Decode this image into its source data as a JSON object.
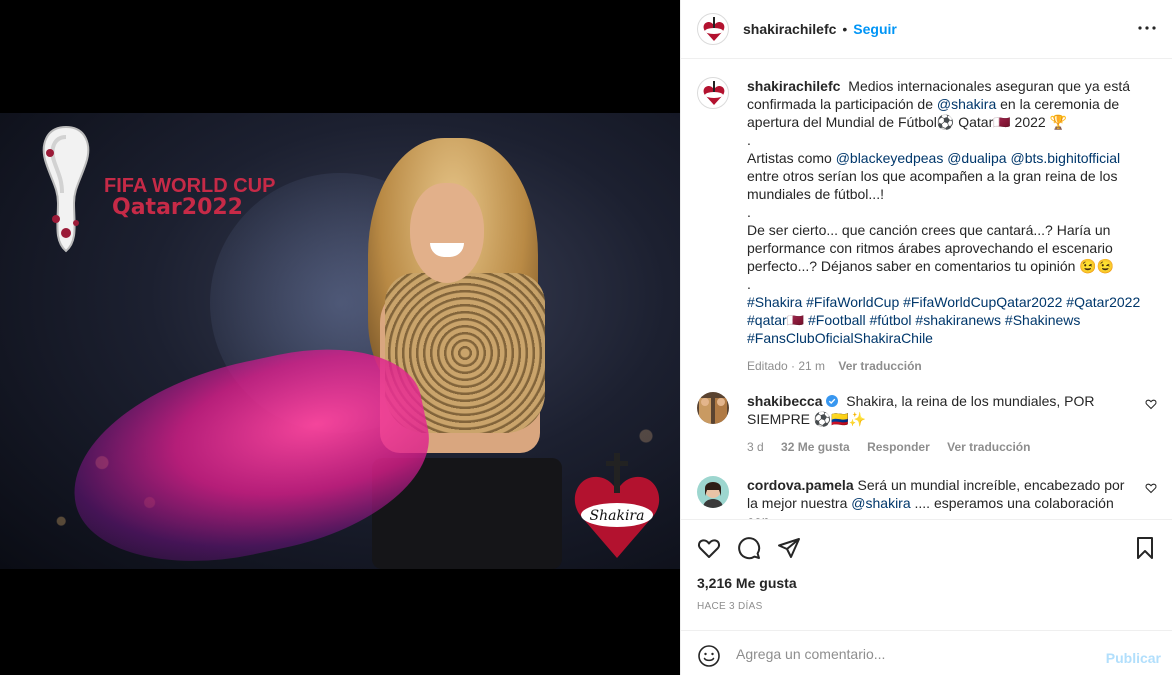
{
  "post": {
    "username": "shakirachilefc",
    "follow_label": "Seguir",
    "separator": "•"
  },
  "media": {
    "logo_line1": "FIFA WORLD CUP",
    "logo_line2": "Qatar2022"
  },
  "caption": {
    "username": "shakirachilefc",
    "lines": [
      "Medios internacionales aseguran que ya está confirmada la participación de",
      "@shakira",
      "en la ceremonia de apertura del Mundial de Fútbol⚽ Qatar🇶🇦 2022 🏆",
      ".",
      "Artistas como",
      "@blackeyedpeas",
      "@dualipa",
      "@bts.bighitofficial",
      "entre otros serían los que acompañen a la gran reina de los mundiales de fútbol...!",
      ".",
      "De ser cierto... que canción crees que cantará...? Haría un performance con ritmos árabes aprovechando el escenario perfecto...? Déjanos saber en comentarios tu opinión 😉😉",
      ".",
      "#Shakira #FifaWorldCup #FifaWorldCupQatar2022 #Qatar2022 #qatar🇶🇦 #Football #fútbol #shakiranews #Shakinews #FansClubOficialShakiraChile"
    ],
    "edited": "Editado · 21 m",
    "see_translation": "Ver traducción"
  },
  "comments": [
    {
      "username": "shakibecca",
      "text": "Shakira, la reina de los mundiales, POR SIEMPRE ⚽🇨🇴✨",
      "time": "3 d",
      "likes": "32 Me gusta",
      "reply": "Responder",
      "translate": "Ver traducción"
    },
    {
      "username": "cordova.pamela",
      "text_before": "Será un mundial increíble, encabezado por la mejor nuestra",
      "mention": "@shakira",
      "text_after": ".... esperamos una colaboración con"
    }
  ],
  "footer": {
    "likes": "3,216 Me gusta",
    "ago": "HACE 3 DÍAS",
    "comment_placeholder": "Agrega un comentario...",
    "publish_label": "Publicar"
  },
  "colors": {
    "accent": "#0095f6",
    "link": "#00376b",
    "muted": "#8e8e8e",
    "publish_disabled": "#b2dffc",
    "fifa_red": "#c62a47"
  }
}
